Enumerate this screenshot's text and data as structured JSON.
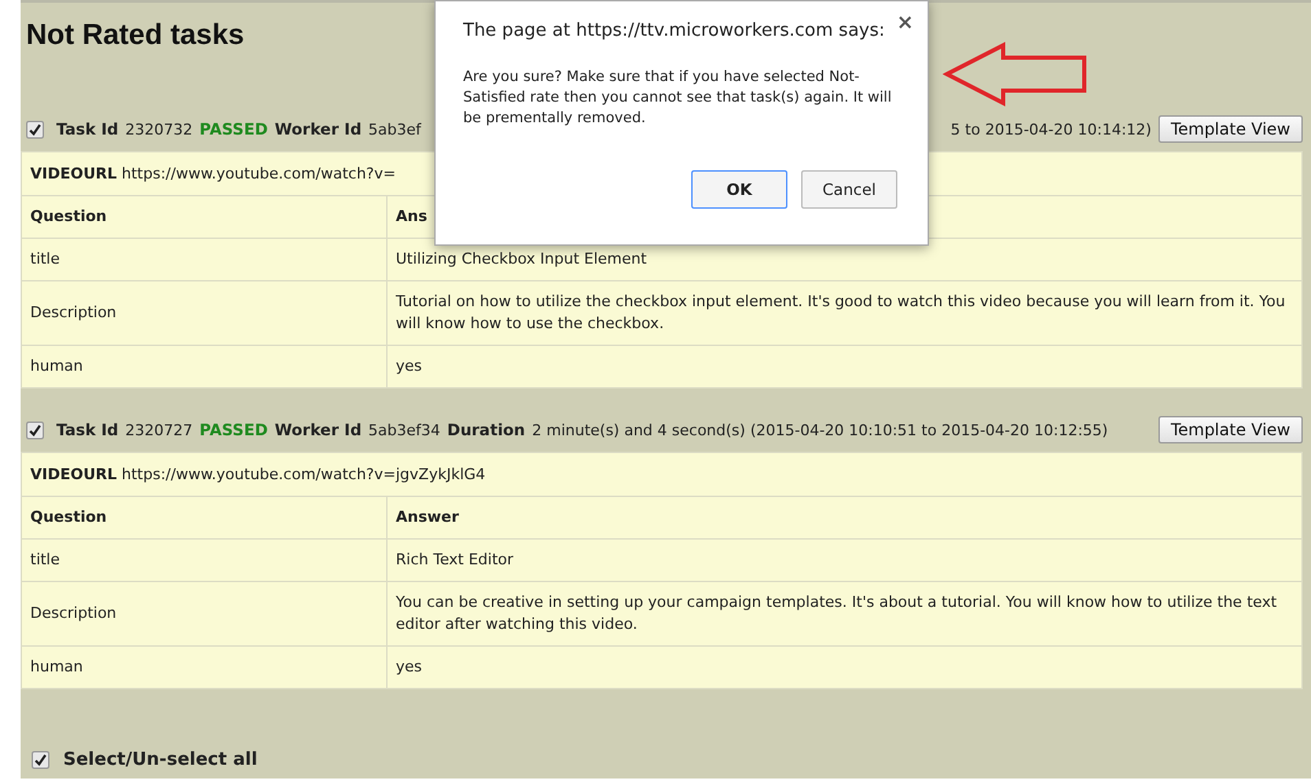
{
  "heading": "Not Rated tasks",
  "tasks": [
    {
      "checked": true,
      "header_left": [
        {
          "kind": "label",
          "text": "Task Id"
        },
        {
          "kind": "value",
          "text": "2320732"
        },
        {
          "kind": "status",
          "text": "PASSED"
        },
        {
          "kind": "label",
          "text": "Worker Id"
        },
        {
          "kind": "value",
          "text": "5ab3ef"
        }
      ],
      "header_right": [
        {
          "kind": "value",
          "text": "5 to 2015-04-20 10:14:12)"
        }
      ],
      "button": "Template View",
      "url": {
        "label": "VIDEOURL",
        "value": "https://www.youtube.com/watch?v="
      },
      "columns": [
        "Question",
        "Ans"
      ],
      "rows": [
        [
          "title",
          "Utilizing Checkbox Input Element"
        ],
        [
          "Description",
          "Tutorial on how to utilize the checkbox input element. It's good to watch this video because you will learn from it. You will know how to use the checkbox."
        ],
        [
          "human",
          "yes"
        ]
      ]
    },
    {
      "checked": true,
      "header_left": [
        {
          "kind": "label",
          "text": "Task Id"
        },
        {
          "kind": "value",
          "text": "2320727"
        },
        {
          "kind": "status",
          "text": "PASSED"
        },
        {
          "kind": "label",
          "text": "Worker Id"
        },
        {
          "kind": "value",
          "text": "5ab3ef34"
        },
        {
          "kind": "label",
          "text": "Duration"
        },
        {
          "kind": "value",
          "text": "2 minute(s) and 4 second(s) (2015-04-20 10:10:51 to 2015-04-20 10:12:55)"
        }
      ],
      "button": "Template View",
      "url": {
        "label": "VIDEOURL",
        "value": "https://www.youtube.com/watch?v=jgvZykJklG4"
      },
      "columns": [
        "Question",
        "Answer"
      ],
      "rows": [
        [
          "title",
          "Rich Text Editor"
        ],
        [
          "Description",
          "You can be creative in setting up your campaign templates. It's about a tutorial. You will know how to utilize the text editor after watching this video."
        ],
        [
          "human",
          "yes"
        ]
      ]
    }
  ],
  "select_all": {
    "label": "Select/Un-select all",
    "checked": true
  },
  "dialog": {
    "title": "The page at https://ttv.microworkers.com says:",
    "close": "×",
    "message": "Are you sure? Make sure that if you have selected Not-Satisfied rate then you cannot see that task(s) again. It will be prementally removed.",
    "buttons": [
      {
        "label": "OK",
        "selected": true
      },
      {
        "label": "Cancel",
        "selected": false
      }
    ]
  }
}
